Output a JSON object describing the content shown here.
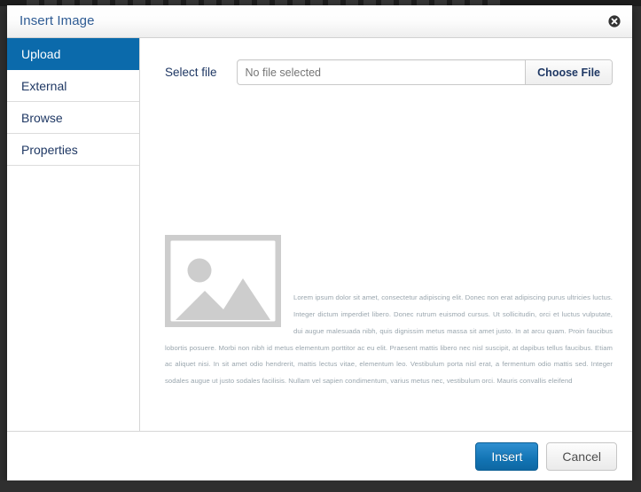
{
  "dialog": {
    "title": "Insert Image",
    "close_icon": "close-circle-icon"
  },
  "sidebar": {
    "items": [
      {
        "label": "Upload",
        "active": true
      },
      {
        "label": "External",
        "active": false
      },
      {
        "label": "Browse",
        "active": false
      },
      {
        "label": "Properties",
        "active": false
      }
    ]
  },
  "upload_panel": {
    "file_label": "Select file",
    "file_value": "",
    "file_placeholder": "No file selected",
    "choose_button": "Choose File",
    "placeholder_image_icon": "image-placeholder-icon",
    "preview_text": "Lorem ipsum dolor sit amet, consectetur adipiscing elit. Donec non erat adipiscing purus ultricies luctus. Integer dictum imperdiet libero. Donec rutrum euismod cursus. Ut sollicitudin, orci et luctus vulputate, dui augue malesuada nibh, quis dignissim metus massa sit amet justo. In at arcu quam. Proin faucibus lobortis posuere. Morbi non nibh id metus elementum porttitor ac eu elit. Praesent mattis libero nec nisl suscipit, at dapibus tellus faucibus. Etiam ac aliquet nisi. In sit amet odio hendrerit, mattis lectus vitae, elementum leo. Vestibulum porta nisl erat, a fermentum odio mattis sed. Integer sodales augue ut justo sodales facilisis. Nullam vel sapien condimentum, varius metus nec, vestibulum orci. Mauris convallis eleifend"
  },
  "footer": {
    "insert_button": "Insert",
    "cancel_button": "Cancel"
  },
  "colors": {
    "accent_blue": "#0b6aab",
    "primary_button": "#1274b4",
    "title_text": "#2f5c94",
    "nav_text": "#1f3864",
    "placeholder_gray": "#cdcdcd",
    "backdrop": "#2f2f2f"
  }
}
